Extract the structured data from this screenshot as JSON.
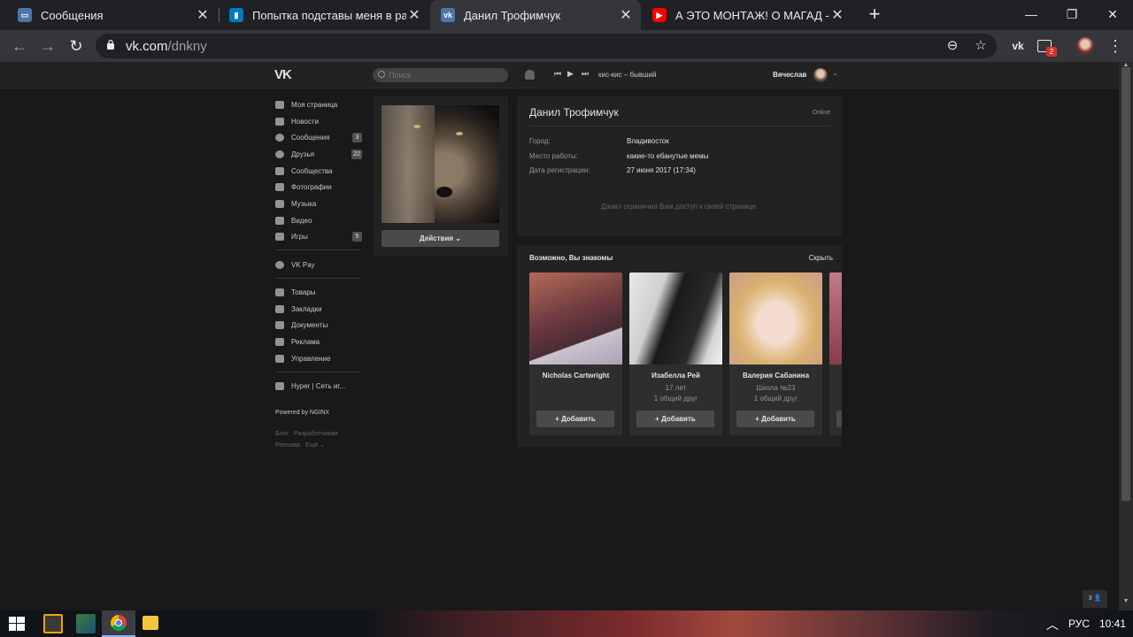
{
  "browser": {
    "tabs": [
      {
        "title": "Сообщения",
        "favicon": "vk-messages"
      },
      {
        "title": "Попытка подставы меня в разд",
        "favicon": "trello"
      },
      {
        "title": "Данил Трофимчук",
        "favicon": "vk",
        "active": true
      },
      {
        "title": "А ЭТО МОНТАЖ! О МАГАД - Yo",
        "favicon": "youtube"
      }
    ],
    "url_domain": "vk.com",
    "url_path": "/dnkny",
    "ext_badge": "2"
  },
  "vk_header": {
    "logo": "VK",
    "search_placeholder": "Поиск",
    "track": "кис-кис – бывший",
    "username": "Вячеслав"
  },
  "menu": {
    "items": [
      {
        "label": "Моя страница"
      },
      {
        "label": "Новости"
      },
      {
        "label": "Сообщения",
        "badge": "3"
      },
      {
        "label": "Друзья",
        "badge": "22"
      },
      {
        "label": "Сообщества"
      },
      {
        "label": "Фотографии"
      },
      {
        "label": "Музыка"
      },
      {
        "label": "Видео"
      },
      {
        "label": "Игры",
        "badge": "5"
      }
    ],
    "vkpay": "VK Pay",
    "items2": [
      {
        "label": "Товары"
      },
      {
        "label": "Закладки"
      },
      {
        "label": "Документы"
      },
      {
        "label": "Реклама"
      },
      {
        "label": "Управление"
      }
    ],
    "hyper": "Hyper | Сеть иг...",
    "powered": "Powered by NGINX",
    "footer": {
      "blog": "Блог",
      "dev": "Разработчикам",
      "ads": "Реклама",
      "more": "Ещё ⌄"
    }
  },
  "profile": {
    "actions_label": "Действия ⌄",
    "name": "Данил Трофимчук",
    "status": "Online",
    "fields": [
      {
        "key": "Город:",
        "value": "Владивосток"
      },
      {
        "key": "Место работы:",
        "value": "какие-то ебанутые мемы"
      },
      {
        "key": "Дата регистрации:",
        "value": "27 июня 2017 (17:34)"
      }
    ],
    "restricted": "Данил ограничил Вам доступ к своей странице."
  },
  "suggestions": {
    "title": "Возможно, Вы знакомы",
    "hide": "Скрыть",
    "people": [
      {
        "name": "Nicholas Cartwright",
        "line1": "",
        "line2": "",
        "add": "+ Добавить"
      },
      {
        "name": "Изабелла Рей",
        "line1": "17 лет",
        "line2": "1 общий друг",
        "add": "+ Добавить"
      },
      {
        "name": "Валерия Сабанина",
        "line1": "Школа №23",
        "line2": "1 общий друг",
        "add": "+ Добавить"
      }
    ]
  },
  "corner_widget": "3 👤",
  "taskbar": {
    "lang": "РУС",
    "time": "10:41"
  }
}
